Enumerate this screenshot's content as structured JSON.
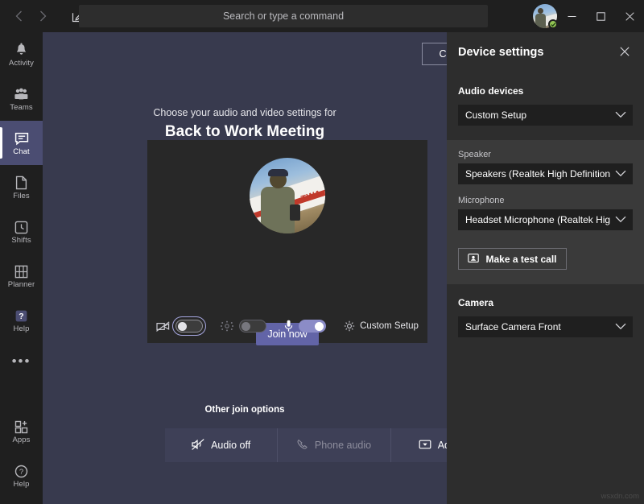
{
  "titlebar": {
    "back_icon": "chevron-left-icon",
    "forward_icon": "chevron-right-icon",
    "compose_icon": "compose-icon",
    "search_placeholder": "Search or type a command",
    "avatar_name": "user-avatar",
    "presence_status": "available",
    "minimize_label": "─",
    "maximize_label": "□",
    "close_label": "✕"
  },
  "rail": {
    "items": [
      {
        "label": "Activity",
        "icon": "bell-icon",
        "active": false
      },
      {
        "label": "Teams",
        "icon": "teams-people-icon",
        "active": false
      },
      {
        "label": "Chat",
        "icon": "chat-bubble-icon",
        "active": true
      },
      {
        "label": "Files",
        "icon": "file-icon",
        "active": false
      },
      {
        "label": "Shifts",
        "icon": "clock-icon",
        "active": false
      },
      {
        "label": "Planner",
        "icon": "planner-grid-icon",
        "active": false
      },
      {
        "label": "Help",
        "icon": "help-filled-icon",
        "active": false
      }
    ],
    "more_label": "•••",
    "bottom_items": [
      {
        "label": "Apps",
        "icon": "apps-icon"
      },
      {
        "label": "Help",
        "icon": "help-circle-icon"
      }
    ]
  },
  "stage": {
    "close_label": "Close",
    "subtitle": "Choose your audio and video settings for",
    "meeting_title": "Back to Work Meeting",
    "join_label": "Join now",
    "controls": {
      "camera": {
        "icon": "camera-off-icon",
        "state": "off",
        "focused": true
      },
      "background": {
        "icon": "background-blur-icon",
        "state": "disabled"
      },
      "microphone": {
        "icon": "microphone-icon",
        "state": "on"
      },
      "settings": {
        "icon": "gear-icon",
        "label": "Custom Setup"
      }
    },
    "other_join_title": "Other join options",
    "other_options": [
      {
        "label": "Audio off",
        "icon": "speaker-off-icon",
        "disabled": false
      },
      {
        "label": "Phone audio",
        "icon": "phone-icon",
        "disabled": true
      },
      {
        "label": "Add a ro",
        "icon": "room-icon",
        "disabled": false
      }
    ]
  },
  "panel": {
    "title": "Device settings",
    "close_icon": "close-icon",
    "audio_section_title": "Audio devices",
    "audio_device_value": "Custom Setup",
    "speaker_label": "Speaker",
    "speaker_value": "Speakers (Realtek High Definition Au...",
    "microphone_label": "Microphone",
    "microphone_value": "Headset Microphone (Realtek High D...",
    "test_call_label": "Make a test call",
    "test_call_icon": "test-call-icon",
    "camera_section_title": "Camera",
    "camera_value": "Surface Camera Front",
    "chevron_icon": "chevron-down-icon"
  },
  "watermark": "wsxdn.com",
  "colors": {
    "brand_purple": "#6264a7",
    "toggle_on": "#8b8cc7",
    "stage_bg": "#383a4e",
    "rail_bg": "#1f1f1f",
    "panel_bg": "#2d2d2d",
    "panel_alt_bg": "#3a3a3a",
    "presence_green": "#92c353"
  }
}
